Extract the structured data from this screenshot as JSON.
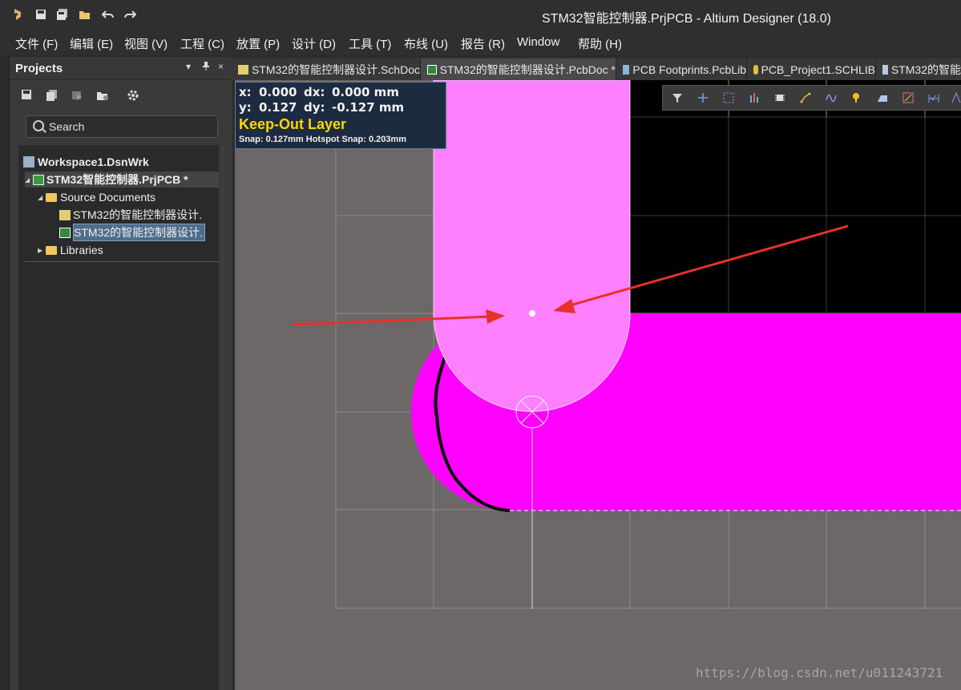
{
  "app": {
    "title": "STM32智能控制器.PrjPCB - Altium Designer (18.0)",
    "quick_access_icons": [
      "altium-logo-icon",
      "save-icon",
      "save-all-icon",
      "open-folder-icon",
      "undo-icon",
      "redo-icon"
    ]
  },
  "menu": [
    {
      "label": "文件 (F)"
    },
    {
      "label": "编辑 (E)"
    },
    {
      "label": "视图 (V)"
    },
    {
      "label": "工程 (C)"
    },
    {
      "label": "放置 (P)"
    },
    {
      "label": "设计 (D)"
    },
    {
      "label": "工具 (T)"
    },
    {
      "label": "布线 (U)"
    },
    {
      "label": "报告 (R)"
    },
    {
      "label": "Window"
    },
    {
      "label": "帮助 (H)"
    }
  ],
  "projects_panel": {
    "title": "Projects",
    "controls": [
      "▾",
      "📌",
      "×"
    ],
    "search_placeholder": "Search",
    "tree": [
      {
        "label": "Workspace1.DsnWrk",
        "icon": "workspace-icon"
      },
      {
        "label": "STM32智能控制器.PrjPCB *",
        "icon": "pcb-project-icon"
      },
      {
        "label": "Source Documents",
        "icon": "folder-icon"
      },
      {
        "label": "STM32的智能控制器设计.",
        "icon": "schematic-doc-icon"
      },
      {
        "label": "STM32的智能控制器设计.",
        "icon": "pcb-doc-icon",
        "selected": true
      },
      {
        "label": "Libraries",
        "icon": "folder-icon"
      }
    ]
  },
  "tabs": [
    {
      "label": "STM32的智能控制器设计.SchDoc",
      "icon": "schematic-doc-icon"
    },
    {
      "label": "STM32的智能控制器设计.PcbDoc *",
      "icon": "pcb-doc-icon",
      "active": true
    },
    {
      "label": "PCB Footprints.PcbLib",
      "icon": "pcblib-icon"
    },
    {
      "label": "PCB_Project1.SCHLIB",
      "icon": "schlib-icon"
    },
    {
      "label": "STM32的智能",
      "icon": "schematic-doc-icon"
    }
  ],
  "heads_up": {
    "x_label": "x:",
    "x_value": "0.000",
    "dx_label": "dx:",
    "dx_value": "0.000 mm",
    "y_label": "y:",
    "y_value": "0.127",
    "dy_label": "dy:",
    "dy_value": "-0.127 mm",
    "layer": "Keep-Out Layer",
    "snap": "Snap: 0.127mm Hotspot Snap: 0.203mm"
  },
  "colors": {
    "keepout_light": "#ff80ff",
    "keepout": "#ff00ff",
    "layer_text": "#ffd800",
    "arrow": "#e8302a",
    "selection": "#4f6c8a"
  },
  "watermark": "https://blog.csdn.net/u011243721"
}
